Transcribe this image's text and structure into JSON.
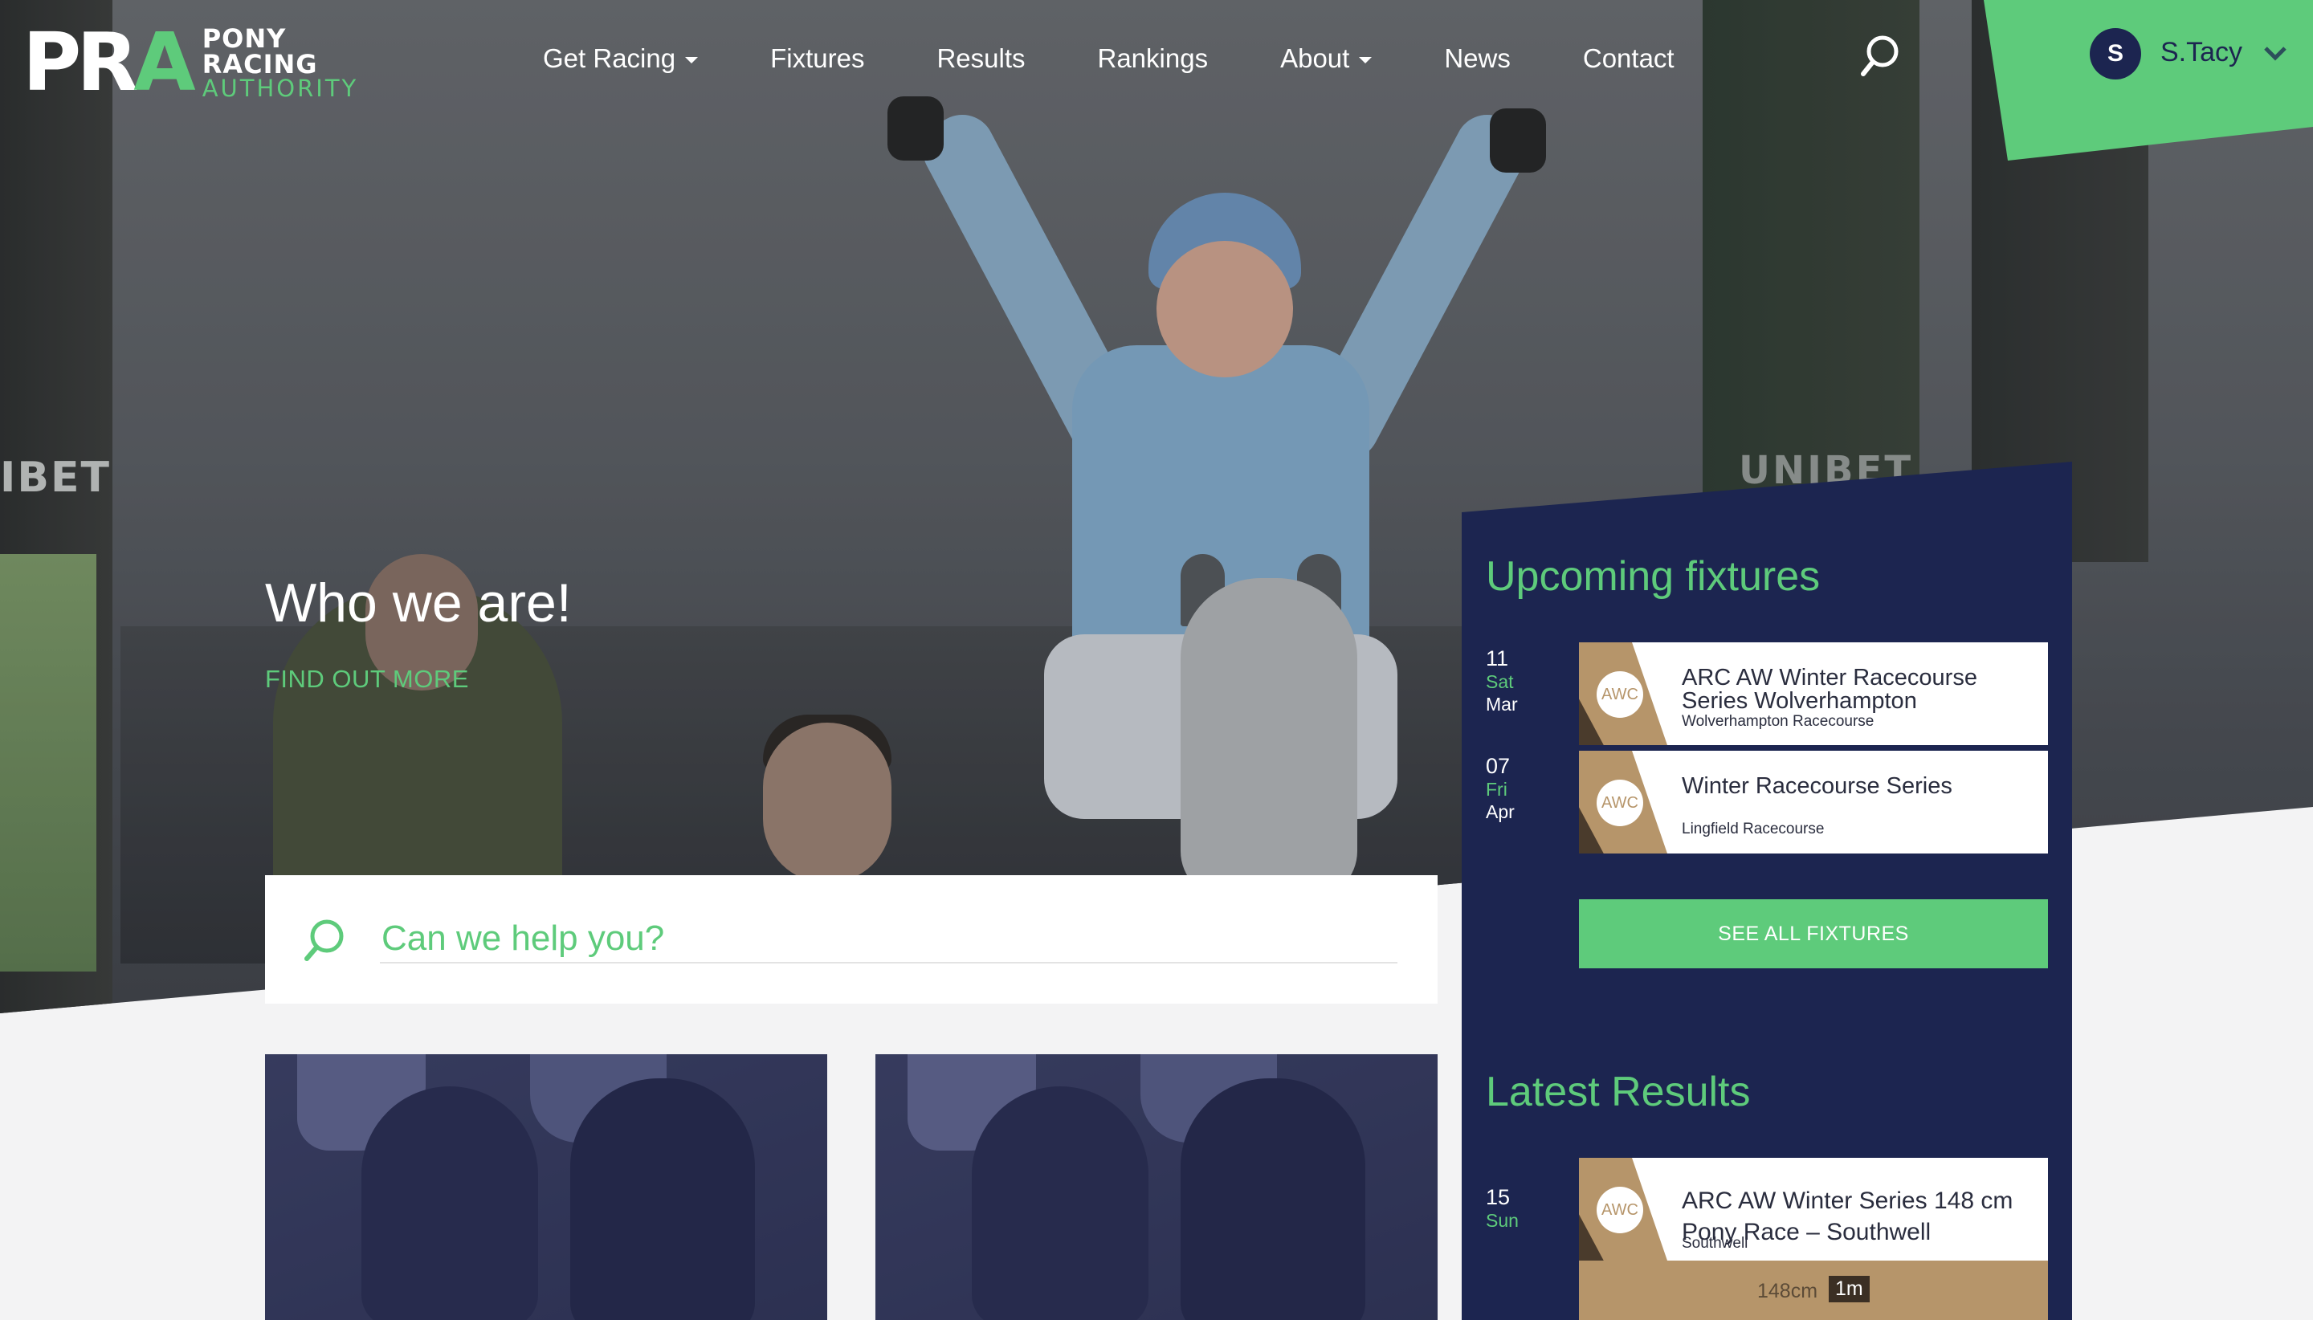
{
  "brand": {
    "logo_mark_a": "PR",
    "logo_mark_b": "A",
    "line1": "PONY",
    "line2": "RACING",
    "line3": "AUTHORITY"
  },
  "nav": {
    "items": [
      {
        "label": "Get Racing",
        "dropdown": true
      },
      {
        "label": "Fixtures",
        "dropdown": false
      },
      {
        "label": "Results",
        "dropdown": false
      },
      {
        "label": "Rankings",
        "dropdown": false
      },
      {
        "label": "About",
        "dropdown": true
      },
      {
        "label": "News",
        "dropdown": false
      },
      {
        "label": "Contact",
        "dropdown": false
      }
    ],
    "search_icon": "search-icon"
  },
  "user": {
    "initial": "S",
    "name": "S.Tacy"
  },
  "hero": {
    "title": "Who we are!",
    "link": "FIND OUT MORE",
    "pillar_left_text": "IBET",
    "pillar_right_text": "UNIBET"
  },
  "search": {
    "label": "Can we help you?"
  },
  "fixtures": {
    "title": "Upcoming fixtures",
    "items": [
      {
        "day": "11",
        "weekday": "Sat",
        "month": "Mar",
        "badge": "AWC",
        "title": "ARC AW Winter Racecourse Series Wolverhampton",
        "venue": "Wolverhampton Racecourse"
      },
      {
        "day": "07",
        "weekday": "Fri",
        "month": "Apr",
        "badge": "AWC",
        "title": "Winter Racecourse Series",
        "venue": "Lingfield Racecourse"
      }
    ],
    "button": "SEE ALL FIXTURES"
  },
  "results": {
    "title": "Latest Results",
    "items": [
      {
        "day": "15",
        "weekday": "Sun",
        "badge": "AWC",
        "title": "ARC AW Winter Series 148 cm Pony Race – Southwell",
        "venue": "Southwell",
        "class": "148cm",
        "distance": "1m"
      }
    ]
  },
  "colors": {
    "accent": "#5ecb7b",
    "navy": "#1c2550",
    "tan": "#b6956a",
    "background": "#f3f3f4"
  }
}
